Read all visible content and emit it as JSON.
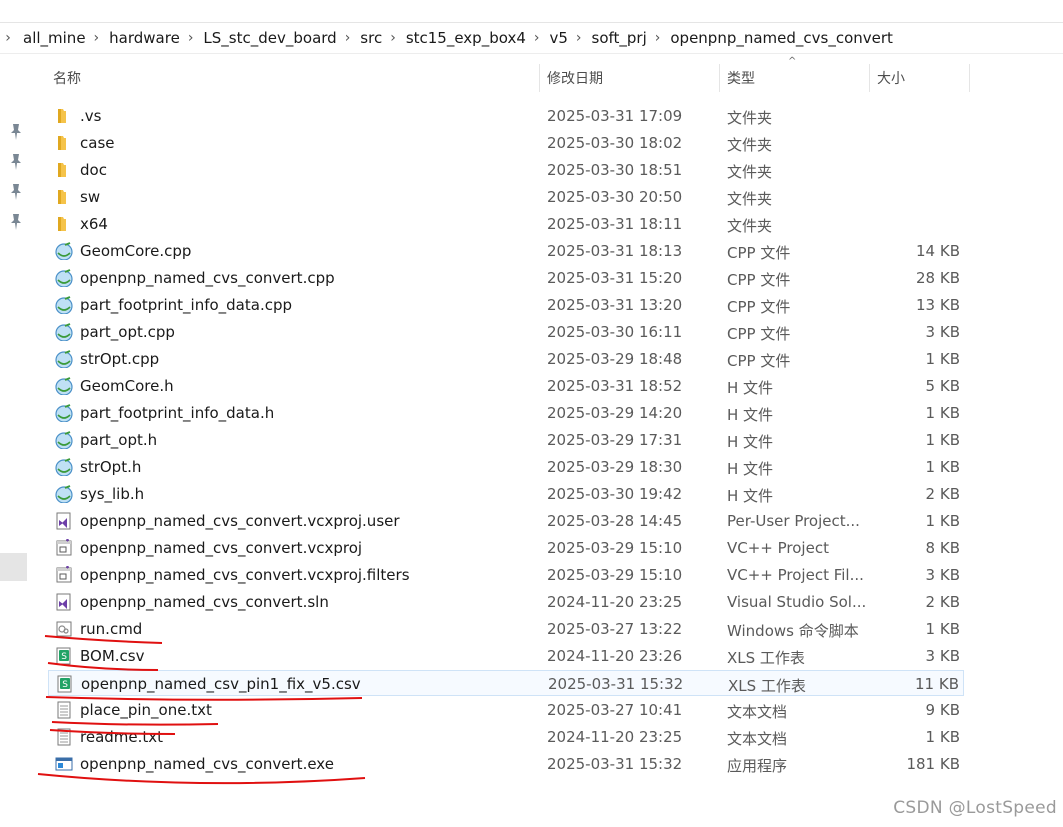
{
  "breadcrumb": [
    "all_mine",
    "hardware",
    "LS_stc_dev_board",
    "src",
    "stc15_exp_box4",
    "v5",
    "soft_prj",
    "openpnp_named_cvs_convert"
  ],
  "columns": {
    "name": "名称",
    "date": "修改日期",
    "type": "类型",
    "size": "大小"
  },
  "sort_indicator": "^",
  "files": [
    {
      "name": ".vs",
      "date": "2025-03-31 17:09",
      "type": "文件夹",
      "size": "",
      "icon": "folder-icon"
    },
    {
      "name": "case",
      "date": "2025-03-30 18:02",
      "type": "文件夹",
      "size": "",
      "icon": "folder-icon"
    },
    {
      "name": "doc",
      "date": "2025-03-30 18:51",
      "type": "文件夹",
      "size": "",
      "icon": "folder-icon"
    },
    {
      "name": "sw",
      "date": "2025-03-30 20:50",
      "type": "文件夹",
      "size": "",
      "icon": "folder-icon"
    },
    {
      "name": "x64",
      "date": "2025-03-31 18:11",
      "type": "文件夹",
      "size": "",
      "icon": "folder-icon"
    },
    {
      "name": "GeomCore.cpp",
      "date": "2025-03-31 18:13",
      "type": "CPP 文件",
      "size": "14 KB",
      "icon": "cpp-file-icon"
    },
    {
      "name": "openpnp_named_cvs_convert.cpp",
      "date": "2025-03-31 15:20",
      "type": "CPP 文件",
      "size": "28 KB",
      "icon": "cpp-file-icon"
    },
    {
      "name": "part_footprint_info_data.cpp",
      "date": "2025-03-31 13:20",
      "type": "CPP 文件",
      "size": "13 KB",
      "icon": "cpp-file-icon"
    },
    {
      "name": "part_opt.cpp",
      "date": "2025-03-30 16:11",
      "type": "CPP 文件",
      "size": "3 KB",
      "icon": "cpp-file-icon"
    },
    {
      "name": "strOpt.cpp",
      "date": "2025-03-29 18:48",
      "type": "CPP 文件",
      "size": "1 KB",
      "icon": "cpp-file-icon"
    },
    {
      "name": "GeomCore.h",
      "date": "2025-03-31 18:52",
      "type": "H 文件",
      "size": "5 KB",
      "icon": "h-file-icon"
    },
    {
      "name": "part_footprint_info_data.h",
      "date": "2025-03-29 14:20",
      "type": "H 文件",
      "size": "1 KB",
      "icon": "h-file-icon"
    },
    {
      "name": "part_opt.h",
      "date": "2025-03-29 17:31",
      "type": "H 文件",
      "size": "1 KB",
      "icon": "h-file-icon"
    },
    {
      "name": "strOpt.h",
      "date": "2025-03-29 18:30",
      "type": "H 文件",
      "size": "1 KB",
      "icon": "h-file-icon"
    },
    {
      "name": "sys_lib.h",
      "date": "2025-03-30 19:42",
      "type": "H 文件",
      "size": "2 KB",
      "icon": "h-file-icon"
    },
    {
      "name": "openpnp_named_cvs_convert.vcxproj.user",
      "date": "2025-03-28 14:45",
      "type": "Per-User Project...",
      "size": "1 KB",
      "icon": "vs-user-file-icon"
    },
    {
      "name": "openpnp_named_cvs_convert.vcxproj",
      "date": "2025-03-29 15:10",
      "type": "VC++ Project",
      "size": "8 KB",
      "icon": "vcxproj-file-icon"
    },
    {
      "name": "openpnp_named_cvs_convert.vcxproj.filters",
      "date": "2025-03-29 15:10",
      "type": "VC++ Project Fil...",
      "size": "3 KB",
      "icon": "filters-file-icon"
    },
    {
      "name": "openpnp_named_cvs_convert.sln",
      "date": "2024-11-20 23:25",
      "type": "Visual Studio Sol...",
      "size": "2 KB",
      "icon": "sln-file-icon"
    },
    {
      "name": "run.cmd",
      "date": "2025-03-27 13:22",
      "type": "Windows 命令脚本",
      "size": "1 KB",
      "icon": "cmd-file-icon"
    },
    {
      "name": "BOM.csv",
      "date": "2024-11-20 23:26",
      "type": "XLS 工作表",
      "size": "3 KB",
      "icon": "csv-file-icon"
    },
    {
      "name": "openpnp_named_csv_pin1_fix_v5.csv",
      "date": "2025-03-31 15:32",
      "type": "XLS 工作表",
      "size": "11 KB",
      "icon": "csv-file-icon",
      "selected": true
    },
    {
      "name": "place_pin_one.txt",
      "date": "2025-03-27 10:41",
      "type": "文本文档",
      "size": "9 KB",
      "icon": "txt-file-icon"
    },
    {
      "name": "readme.txt",
      "date": "2024-11-20 23:25",
      "type": "文本文档",
      "size": "1 KB",
      "icon": "txt-file-icon"
    },
    {
      "name": "openpnp_named_cvs_convert.exe",
      "date": "2025-03-31 15:32",
      "type": "应用程序",
      "size": "181 KB",
      "icon": "exe-file-icon"
    }
  ],
  "watermark": "CSDN @LostSpeed",
  "colors": {
    "folder": "#f5c34a",
    "csv_green": "#21a366",
    "selection_border": "#cfe3f7",
    "annotation_red": "#e01010",
    "vs_purple": "#6d3fa8"
  }
}
